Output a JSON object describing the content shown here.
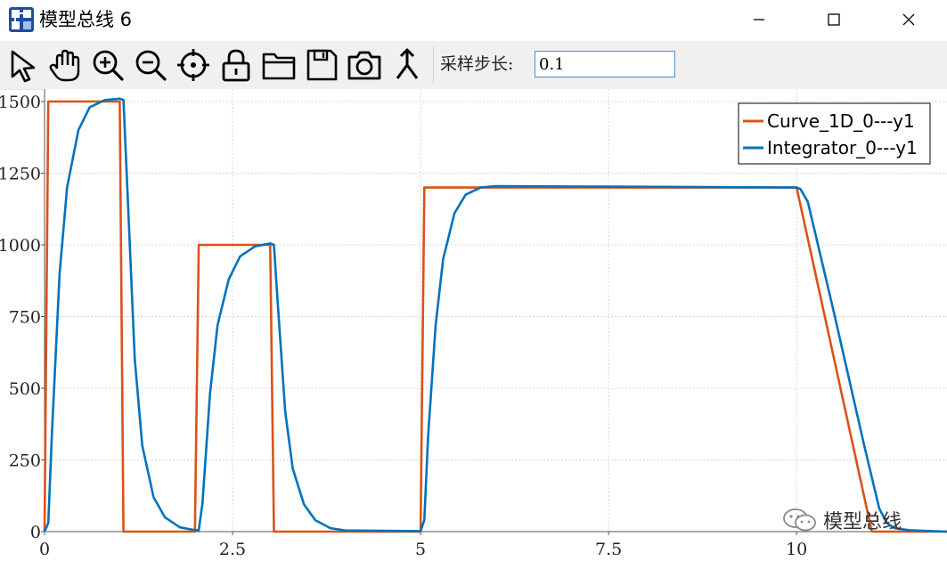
{
  "window": {
    "title": "模型总线 6",
    "minimize_icon": "minimize-icon",
    "maximize_icon": "maximize-icon",
    "close_icon": "close-icon"
  },
  "toolbar": {
    "tools": [
      "select-arrow-icon",
      "pan-hand-icon",
      "zoom-in-icon",
      "zoom-out-icon",
      "crosshair-icon",
      "lock-icon",
      "open-folder-icon",
      "save-icon",
      "camera-icon",
      "branch-icon"
    ],
    "step_label": "采样步长:",
    "step_value": "0.1"
  },
  "watermark": {
    "text": "模型总线",
    "icon": "wechat-icon"
  },
  "colors": {
    "curve": "#d95319",
    "integrator": "#0072bd",
    "grid": "#d8d8d8"
  },
  "chart_data": {
    "type": "line",
    "title": "",
    "xlabel": "",
    "ylabel": "",
    "xlim": [
      0,
      12
    ],
    "ylim": [
      0,
      1500
    ],
    "xticks": [
      0,
      2.5,
      5,
      7.5,
      10
    ],
    "xtick_labels": [
      "0",
      "2.5",
      "5",
      "7.5",
      "10"
    ],
    "yticks": [
      0,
      250,
      500,
      750,
      1000,
      1250,
      1500
    ],
    "ytick_labels": [
      "0",
      "250",
      "500",
      "750",
      "1000",
      "1250",
      "1500"
    ],
    "grid": true,
    "legend_position": "top-right",
    "series": [
      {
        "name": "Curve_1D_0---y1",
        "x": [
          0,
          0.05,
          1.0,
          1.05,
          2.0,
          2.05,
          3.0,
          3.05,
          5.0,
          5.05,
          10.0,
          11.0,
          12.0
        ],
        "y": [
          0,
          1500,
          1500,
          0,
          0,
          1000,
          1000,
          0,
          0,
          1200,
          1200,
          0,
          0
        ]
      },
      {
        "name": "Integrator_0---y1",
        "x": [
          0,
          0.05,
          0.1,
          0.2,
          0.3,
          0.45,
          0.6,
          0.8,
          1.0,
          1.05,
          1.1,
          1.2,
          1.3,
          1.45,
          1.6,
          1.8,
          2.0,
          2.05,
          2.1,
          2.2,
          2.3,
          2.45,
          2.6,
          2.8,
          3.0,
          3.05,
          3.1,
          3.2,
          3.3,
          3.45,
          3.6,
          3.8,
          4.0,
          5.0,
          5.05,
          5.1,
          5.2,
          5.3,
          5.45,
          5.6,
          5.8,
          6.0,
          7.5,
          10.0,
          10.05,
          10.15,
          10.5,
          10.9,
          11.1,
          11.2,
          11.3,
          11.5,
          11.8,
          12.0
        ],
        "y": [
          0,
          30,
          350,
          900,
          1200,
          1400,
          1480,
          1505,
          1510,
          1505,
          1200,
          600,
          300,
          120,
          50,
          15,
          5,
          5,
          100,
          480,
          720,
          880,
          960,
          995,
          1005,
          1000,
          800,
          420,
          220,
          95,
          40,
          12,
          4,
          2,
          40,
          330,
          720,
          950,
          1110,
          1175,
          1200,
          1205,
          1203,
          1200,
          1195,
          1150,
          760,
          300,
          80,
          30,
          12,
          5,
          2,
          0
        ]
      }
    ]
  }
}
